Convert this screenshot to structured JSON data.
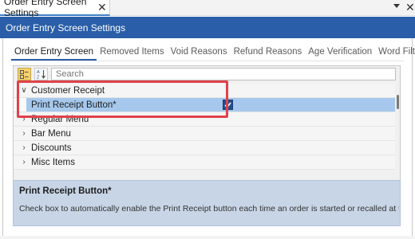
{
  "document_tab": {
    "title": "Order Entry Screen Settings",
    "close_glyph": "✕"
  },
  "window": {
    "close_glyph": "✕"
  },
  "header": {
    "title": "Order Entry Screen Settings"
  },
  "tabs": [
    {
      "label": "Order Entry Screen",
      "active": true
    },
    {
      "label": "Removed Items",
      "active": false
    },
    {
      "label": "Void Reasons",
      "active": false
    },
    {
      "label": "Refund Reasons",
      "active": false
    },
    {
      "label": "Age Verification",
      "active": false
    },
    {
      "label": "Word Filters",
      "active": false
    }
  ],
  "toolbar": {
    "categorized_icon": "categorized-view-icon",
    "alphabetical_icon": "alphabetical-sort-icon",
    "search_placeholder": "Search"
  },
  "grid": {
    "rows": [
      {
        "type": "category",
        "label": "Customer Receipt",
        "expanded": true,
        "chevron": "∨"
      },
      {
        "type": "property",
        "label": "Print Receipt Button*",
        "value": true,
        "selected": true
      },
      {
        "type": "category",
        "label": "Regular Menu",
        "expanded": false,
        "chevron": "›"
      },
      {
        "type": "category",
        "label": "Bar Menu",
        "expanded": false,
        "chevron": "›"
      },
      {
        "type": "category",
        "label": "Discounts",
        "expanded": false,
        "chevron": "›"
      },
      {
        "type": "category",
        "label": "Misc Items",
        "expanded": false,
        "chevron": "›"
      }
    ]
  },
  "description": {
    "title": "Print Receipt Button*",
    "text": "Check box to automatically enable the Print Receipt button each time an order is started or recalled at this pos sta..."
  },
  "colors": {
    "accent": "#2a5ea8",
    "highlight_border": "#e0424a",
    "selection": "#a6c8ec",
    "description_bg": "#c8d5e6"
  }
}
